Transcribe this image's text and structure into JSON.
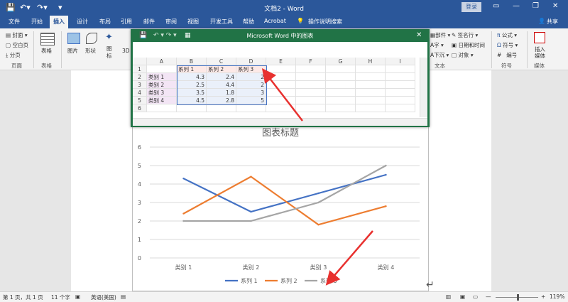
{
  "app": {
    "title": "文档2 - Word",
    "login_label": "登录",
    "share_label": "共享",
    "minimize_icon": "—",
    "restore_icon": "❐",
    "close_icon": "✕"
  },
  "tabs": [
    "文件",
    "开始",
    "插入",
    "设计",
    "布局",
    "引用",
    "邮件",
    "审阅",
    "视图",
    "开发工具",
    "帮助",
    "Acrobat"
  ],
  "tell_me": "操作说明搜索",
  "ribbon": {
    "pages": {
      "items": [
        "封面",
        "空白页",
        "分页"
      ],
      "label": "页面"
    },
    "table": {
      "button": "表格",
      "label": "表格"
    },
    "illustrations": {
      "picture": "图片",
      "shapes": "形状",
      "icons": "图标",
      "models_partial": "3D 模"
    },
    "text_right": {
      "col1": [
        "部件",
        "字",
        "下沉"
      ],
      "col2": [
        "签名行",
        "日期和时间",
        "对象"
      ],
      "label": "文本"
    },
    "symbols": {
      "items": [
        "公式",
        "符号",
        "编号"
      ],
      "label": "符号"
    },
    "media": {
      "button_line1": "插入",
      "button_line2": "媒体",
      "label": "媒体"
    }
  },
  "excel": {
    "title": "Microsoft Word 中的图表",
    "columns": [
      "A",
      "B",
      "C",
      "D",
      "E",
      "F",
      "G",
      "H",
      "I"
    ],
    "rows": [
      [
        "",
        "系列 1",
        "系列 2",
        "系列 3"
      ],
      [
        "类别 1",
        "4.3",
        "2.4",
        "2"
      ],
      [
        "类别 2",
        "2.5",
        "4.4",
        "2"
      ],
      [
        "类别 3",
        "3.5",
        "1.8",
        "3"
      ],
      [
        "类别 4",
        "4.5",
        "2.8",
        "5"
      ],
      [
        "",
        "",
        "",
        ""
      ]
    ],
    "row_numbers": [
      "1",
      "2",
      "3",
      "4",
      "5",
      "6"
    ]
  },
  "chart_data": {
    "type": "line",
    "title": "图表标题",
    "categories": [
      "类别 1",
      "类别 2",
      "类别 3",
      "类别 4"
    ],
    "series": [
      {
        "name": "系列 1",
        "values": [
          4.3,
          2.5,
          3.5,
          4.5
        ],
        "color": "#4472c4"
      },
      {
        "name": "系列 2",
        "values": [
          2.4,
          4.4,
          1.8,
          2.8
        ],
        "color": "#ed7d31"
      },
      {
        "name": "系列 3",
        "values": [
          2,
          2,
          3,
          5
        ],
        "color": "#a5a5a5"
      }
    ],
    "ylim": [
      0,
      6
    ],
    "yticks": [
      0,
      1,
      2,
      3,
      4,
      5,
      6
    ],
    "grid": true,
    "legend": "bottom"
  },
  "status": {
    "page": "第 1 页，共 1 页",
    "words": "11 个字",
    "language": "英语(美国)",
    "zoom": "119%"
  },
  "colors": {
    "accent": "#2b579a",
    "excel": "#217346",
    "annotation": "#e8312f"
  }
}
